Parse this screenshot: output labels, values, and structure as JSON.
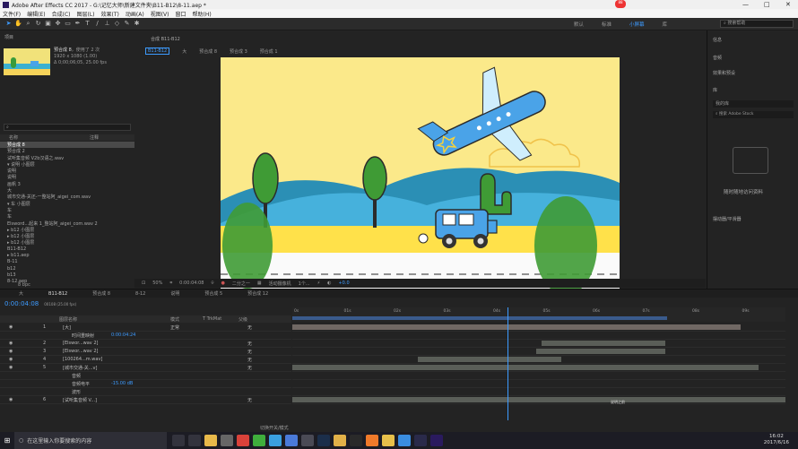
{
  "window": {
    "title": "Adobe After Effects CC 2017 - G:\\记忆大师\\新建文件夹\\B11-B12\\8-11.aep *"
  },
  "menu": [
    "文件(F)",
    "编辑(E)",
    "合成(C)",
    "图层(L)",
    "效果(T)",
    "动画(A)",
    "视图(V)",
    "窗口",
    "帮助(H)"
  ],
  "workspace": {
    "items": [
      "默认",
      "标准",
      "小屏幕",
      "库"
    ],
    "active": "小屏幕",
    "search_placeholder": "搜索帮助"
  },
  "project": {
    "panel_title": "项目",
    "comp_name": "预合成 8",
    "used": "，使用了 2 次",
    "size": "1920 x 1080 (1.00)",
    "duration": "Δ 0;00;06;05, 25.00 fps",
    "search_placeholder": "",
    "col_name": "名称",
    "col_note": "注释",
    "items": [
      "预合成 8",
      "预合成 2",
      "试听集音频 V2b汉语之.wav",
      "▾ 说明 小图层",
      "说明",
      "说明",
      "画帆 3",
      "大",
      "城市交通-关还-一整站阿_aigei_com.wav",
      "▾ 车 小图层",
      "车",
      "车",
      "Elsword...起来 1_整站阿_aigei_com.wav 2",
      "▸ b12 小图层",
      "▸ b12 小图层",
      "▸ b12 小图层",
      "B11-B12",
      "▸ b11.aep",
      "B-11",
      "b12",
      "b13",
      "8-12.aep"
    ],
    "bpc": "8 bpc"
  },
  "composition": {
    "panel_title": "合成 B11-B12",
    "breadcrumbs": [
      "B11-B12",
      "大",
      "预合成 8",
      "预合成 3",
      "预合成 1"
    ],
    "zoom": "50%",
    "timecode": "0:00:04:08",
    "resolution": "二分之一",
    "camera": "活动摄像机",
    "views": "1个...",
    "exposure": "+0.0"
  },
  "right_panels": {
    "info": "信息",
    "audio": "音频",
    "effects": "效果和预设",
    "library": "库",
    "library_select": "我的库",
    "library_search": "搜索 Adobe Stock",
    "lib_message": "随时随地访问资料",
    "smoother": "摆动器/平滑器"
  },
  "timeline": {
    "tabs": [
      "大",
      "B11-B12",
      "预合成 8",
      "8-12",
      "说明",
      "预合成 5",
      "预合成 12"
    ],
    "active_tab": "B11-B12",
    "timecode": "0:00:04:08",
    "frames": "00108 (25.00 fps)",
    "col_headers": {
      "layer": "图层名称",
      "mode": "模式",
      "trkmat": "T TrkMat",
      "parent": "父级"
    },
    "layers": [
      {
        "num": "1",
        "name": "[大]",
        "mode": "正常",
        "parent": "无"
      },
      {
        "num": "",
        "name": "时间重映射",
        "value": "0:00:04:24",
        "parent": ""
      },
      {
        "num": "2",
        "name": "[Elswor...wav 2]",
        "mode": "",
        "parent": "无"
      },
      {
        "num": "3",
        "name": "[Elswor...wav 2]",
        "mode": "",
        "parent": "无"
      },
      {
        "num": "4",
        "name": "[100264...m.wav]",
        "mode": "",
        "parent": "无"
      },
      {
        "num": "5",
        "name": "[城市交通-关...v]",
        "mode": "",
        "parent": "无"
      },
      {
        "num": "",
        "name": "音频",
        "value": "",
        "parent": ""
      },
      {
        "num": "",
        "name": "音频电平",
        "value": "-15.00 dB",
        "parent": ""
      },
      {
        "num": "",
        "name": "波形",
        "value": "",
        "parent": ""
      },
      {
        "num": "6",
        "name": "[试听集音频 V...]",
        "mode": "",
        "parent": "无"
      }
    ],
    "ruler": [
      "0s",
      "01s",
      "02s",
      "03s",
      "04s",
      "05s",
      "06s",
      "07s",
      "08s",
      "09s"
    ],
    "bottom_label": "切换开关/模式",
    "marker": "说明之前"
  },
  "taskbar": {
    "search_placeholder": "在这里输入你要搜索的内容",
    "time": "16:02",
    "date": "2017/6/16"
  }
}
